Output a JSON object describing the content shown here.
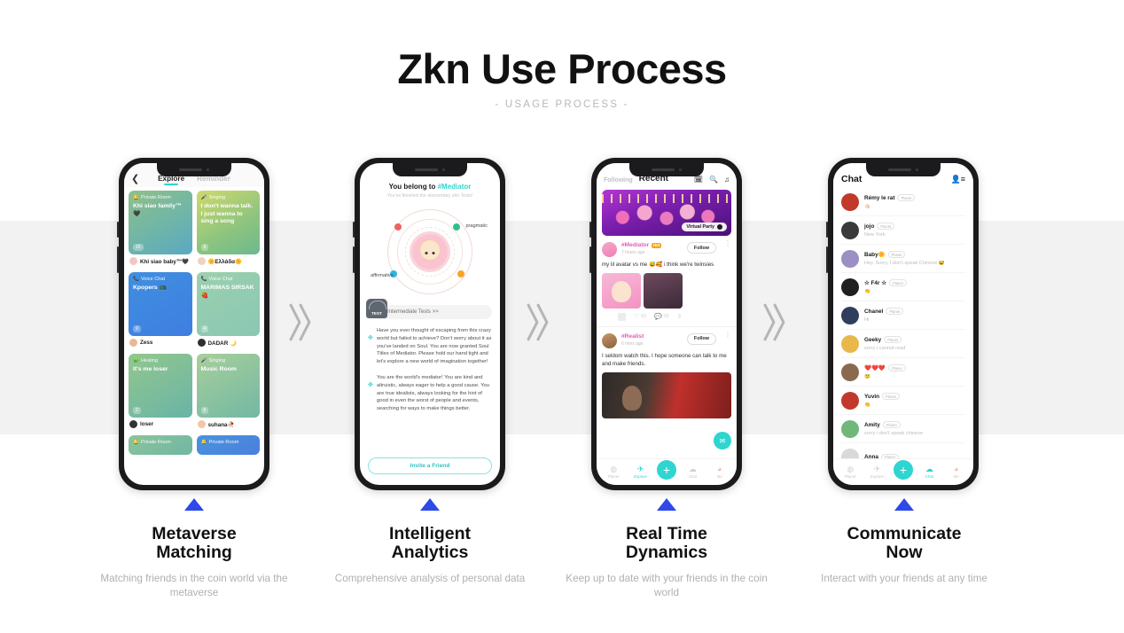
{
  "header": {
    "title": "Zkn Use Process",
    "subtitle": "- USAGE PROCESS -"
  },
  "colors": {
    "accent_teal": "#2fd5d0",
    "accent_blue": "#2e49e8",
    "band_gray": "#f2f2f2",
    "chevron_gray": "#b5b5b5",
    "pink": "#e35db8"
  },
  "steps": [
    {
      "title": "Metaverse\nMatching",
      "title_line1": "Metaverse",
      "title_line2": "Matching",
      "description": "Matching friends in the coin world via the metaverse",
      "marker": "triangle-up"
    },
    {
      "title_line1": "Intelligent",
      "title_line2": "Analytics",
      "description": "Comprehensive analysis of personal data",
      "marker": "triangle-up"
    },
    {
      "title_line1": "Real Time",
      "title_line2": "Dynamics",
      "description": "Keep up to date with your friends in the coin world",
      "marker": "triangle-up"
    },
    {
      "title_line1": "Communicate",
      "title_line2": "Now",
      "description": "Interact with your friends at any time",
      "marker": "triangle-up"
    }
  ],
  "separators": [
    "double-chevron-right",
    "double-chevron-right",
    "double-chevron-right"
  ],
  "phone1": {
    "back_icon": "chevron-left-icon",
    "tabs": [
      {
        "label": "Explore",
        "active": true
      },
      {
        "label": "Reminder",
        "active": false
      }
    ],
    "cards": [
      {
        "tag": "Private Room",
        "tag_icon": "🔔",
        "name": "Khi siao family™🖤",
        "count": "15",
        "user": "Khi siao baby™🖤",
        "gradient": "g1",
        "avatar": "#f3c6c6"
      },
      {
        "tag": "Singing",
        "tag_icon": "🎤",
        "name": "I don't wanna talk. I just wanna to sing a song",
        "count": "3",
        "user": "🌼Ελλάδα🌼",
        "gradient": "g2",
        "avatar": "#f0d2c0"
      },
      {
        "tag": "Voice Chat",
        "tag_icon": "📞",
        "name": "Kpopers 📺",
        "count": "9",
        "user": "Zess",
        "gradient": "g3",
        "avatar": "#e8b893"
      },
      {
        "tag": "Voice Chat",
        "tag_icon": "📞",
        "name": "MARIMAS SIRSAK 🍓",
        "count": "4",
        "user": "DADAR 🌙",
        "gradient": "g4",
        "avatar": "#2f2f2f"
      },
      {
        "tag": "Healing",
        "tag_icon": "🧩",
        "name": "It's me loser",
        "count": "2",
        "user": "loser",
        "gradient": "g5",
        "avatar": "#333333"
      },
      {
        "tag": "Singing",
        "tag_icon": "🎤",
        "name": "Music Room",
        "count": "6",
        "user": "suhana🥀",
        "gradient": "g6",
        "avatar": "#f0c8a8"
      },
      {
        "tag": "Private Room",
        "tag_icon": "🔔",
        "name": "",
        "count": "",
        "user": "",
        "gradient": "g7",
        "avatar": "#cccccc"
      },
      {
        "tag": "Private Room",
        "tag_icon": "🔔",
        "name": "",
        "count": "",
        "user": "",
        "gradient": "g8",
        "avatar": "#cccccc"
      }
    ]
  },
  "phone2": {
    "heading_prefix": "You belong to ",
    "heading_tag": "#Mediator",
    "subheading": "You've finished the elementary zkn Tests!",
    "traits": [
      {
        "label": "",
        "color": "#f0625e",
        "position": "top-left"
      },
      {
        "label": "pragmatic",
        "color": "#2fc08a",
        "position": "right"
      },
      {
        "label": "affirmative",
        "color": "#2fb6e0",
        "position": "left"
      },
      {
        "label": "",
        "color": "#f5a623",
        "position": "bottom-right"
      }
    ],
    "test_badge": "TEST",
    "test_link": "Intermediate Tests >>",
    "paragraphs": [
      "Have you ever thought of escaping from this crazy world but failed to achieve? Don't worry about it as you've landed on Soul. You are now granted Soul Titles of Mediator. Please hold our hand tight and let's explore a new world of imagination together!",
      "You are the world's mediator! You are kind and altruistic, always eager to help a good cause. You are true idealists, always looking for the hint of good in even the worst of people and events, searching for ways to make things better."
    ],
    "invite_button": "Invite a Friend"
  },
  "phone3": {
    "tabs": [
      {
        "label": "Following",
        "active": false
      },
      {
        "label": "Recent",
        "active": true
      }
    ],
    "header_icons": [
      "calendar-icon",
      "search-icon",
      "music-icon"
    ],
    "banner_chip": "Virtual Party",
    "posts": [
      {
        "username": "#Mediator",
        "badge": "Hot",
        "time": "7 hours ago",
        "follow_label": "Follow",
        "body": "my lil avatar vs me 😅🥰 i think we're twinsies",
        "likes": "62",
        "comments": "10"
      },
      {
        "username": "#Realist",
        "time": "6 mins ago",
        "follow_label": "Follow",
        "body": "I seldom watch this. I hope someone can talk to me and make friends."
      }
    ],
    "mail_button_icon": "envelope-icon",
    "nav": [
      {
        "label": "Planet",
        "icon": "planet-icon",
        "active": false
      },
      {
        "label": "Explore",
        "icon": "explore-icon",
        "active": true
      },
      {
        "label": "",
        "icon": "plus-icon",
        "active": false
      },
      {
        "label": "Chat",
        "icon": "chat-icon",
        "active": false
      },
      {
        "label": "Me",
        "icon": "me-icon",
        "active": false
      }
    ]
  },
  "phone4": {
    "title": "Chat",
    "header_icon": "add-contact-icon",
    "rows": [
      {
        "name": "Rémy le rat",
        "tag": "Planet",
        "msg": "🤙🏻",
        "avatar": "#c0392b"
      },
      {
        "name": "jojo",
        "tag": "Planet",
        "msg": "New York",
        "avatar": "#3a3a3a"
      },
      {
        "name": "Baby🌼",
        "tag": "Planet",
        "msg": "Hey. Sorry, I don't speak Chinese 😅",
        "avatar": "#9b8fc4"
      },
      {
        "name": "☆ F4r ☆",
        "tag": "Planet",
        "msg": "👏",
        "avatar": "#1f1f1f"
      },
      {
        "name": "Chanel",
        "tag": "Planet",
        "msg": "Hi",
        "avatar": "#2f3e5c"
      },
      {
        "name": "Geeky",
        "tag": "Planet",
        "msg": "sorry i cannot read",
        "avatar": "#e8b84b"
      },
      {
        "name": "❤️❤️❤️",
        "tag": "Planet",
        "msg": "😇",
        "avatar": "#8a6a4e"
      },
      {
        "name": "Yuvin",
        "tag": "Planet",
        "msg": "👏",
        "avatar": "#c0392b"
      },
      {
        "name": "Amity",
        "tag": "Planet",
        "msg": "sorry i don't speak chinese",
        "avatar": "#6fb87a"
      },
      {
        "name": "Anna",
        "tag": "Planet",
        "msg": "",
        "avatar": "#d9d9d9"
      }
    ],
    "nav": [
      {
        "label": "Planet",
        "icon": "planet-icon",
        "active": false
      },
      {
        "label": "Explore",
        "icon": "explore-icon",
        "active": false
      },
      {
        "label": "",
        "icon": "plus-icon",
        "active": false
      },
      {
        "label": "Chat",
        "icon": "chat-icon",
        "active": true
      },
      {
        "label": "Me",
        "icon": "me-icon",
        "active": false
      }
    ]
  }
}
